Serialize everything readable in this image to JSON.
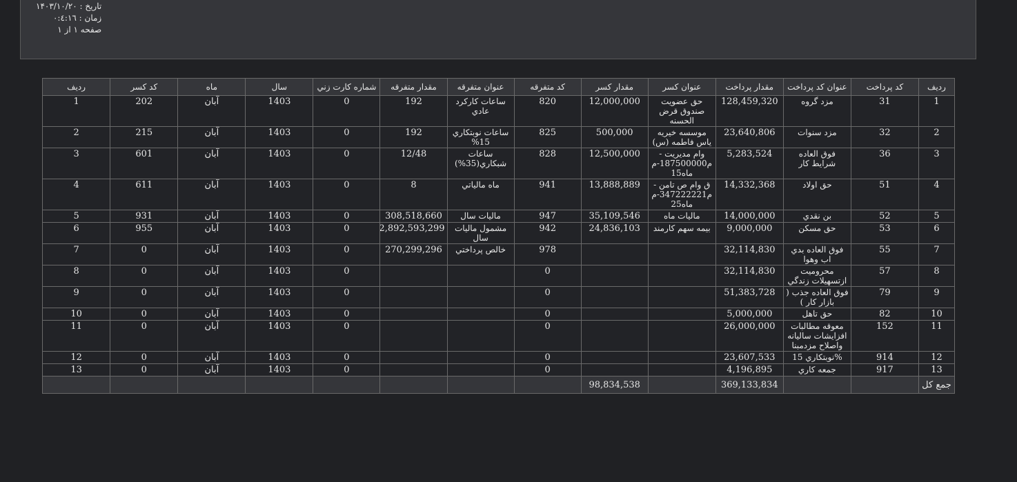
{
  "header": {
    "date_line": "تاريخ : ۱۴۰۳/۱۰/۲۰",
    "time_line": "زمان : ۰:٤:۱٦",
    "page_line": "صفحه ۱ از ۱"
  },
  "columns": [
    "رديف",
    "کد پرداخت",
    "عنوان کد پرداخت",
    "مقدار پرداخت",
    "عنوان کسر",
    "مقدار کسر",
    "کد متفرقه",
    "عنوان متفرقه",
    "مقدار متفرقه",
    "شماره کارت زني",
    "سال",
    "ماه",
    "کد کسر",
    "رديف"
  ],
  "rows": [
    [
      "1",
      "31",
      "مزد گروه",
      "128,459,320",
      "حق عضويت صندوق قرض الحسنه",
      "12,000,000",
      "820",
      "ساعات کارکرد عادي",
      "192",
      "0",
      "1403",
      "آبان",
      "202",
      "1"
    ],
    [
      "2",
      "32",
      "مزد سنوات",
      "23,640,806",
      "موسسه خيريه ياس فاطمه (س)",
      "500,000",
      "825",
      "ساعات نوبتکاري 15%",
      "192",
      "0",
      "1403",
      "آبان",
      "215",
      "2"
    ],
    [
      "3",
      "36",
      "فوق العاده شرايط کار",
      "5,283,524",
      "وام مديريت - م187500000-م ماه15",
      "12,500,000",
      "828",
      "ساعات شبکاري(35%)",
      "12/48",
      "0",
      "1403",
      "آبان",
      "601",
      "3"
    ],
    [
      "4",
      "51",
      "حق اولاد",
      "14,332,368",
      "ق وام ص تامن - م347222221-م ماه25",
      "13,888,889",
      "941",
      "ماه مالياتي",
      "8",
      "0",
      "1403",
      "آبان",
      "611",
      "4"
    ],
    [
      "5",
      "52",
      "بن نقدي",
      "14,000,000",
      "ماليات ماه",
      "35,109,546",
      "947",
      "ماليات سال",
      "308,518,660",
      "0",
      "1403",
      "آبان",
      "931",
      "5"
    ],
    [
      "6",
      "53",
      "حق مسکن",
      "9,000,000",
      "بيمه سهم کارمند",
      "24,836,103",
      "942",
      "مشمول ماليات سال",
      "2,892,593,299",
      "0",
      "1403",
      "آبان",
      "955",
      "6"
    ],
    [
      "7",
      "55",
      "فوق العاده بدي اب وهوا",
      "32,114,830",
      "",
      "",
      "978",
      "خالص پرداختي",
      "270,299,296",
      "0",
      "1403",
      "آبان",
      "0",
      "7"
    ],
    [
      "8",
      "57",
      "محروميت ازتسهيلات زندگي",
      "32,114,830",
      "",
      "",
      "0",
      "",
      "",
      "0",
      "1403",
      "آبان",
      "0",
      "8"
    ],
    [
      "9",
      "79",
      "فوق العاده جذب ( بازار کار )",
      "51,383,728",
      "",
      "",
      "0",
      "",
      "",
      "0",
      "1403",
      "آبان",
      "0",
      "9"
    ],
    [
      "10",
      "82",
      "حق تاهل",
      "5,000,000",
      "",
      "",
      "0",
      "",
      "",
      "0",
      "1403",
      "آبان",
      "0",
      "10"
    ],
    [
      "11",
      "152",
      "معوقه مطالبات افزايشات ساليانه واصلاح مزدمبنا",
      "26,000,000",
      "",
      "",
      "0",
      "",
      "",
      "0",
      "1403",
      "آبان",
      "0",
      "11"
    ],
    [
      "12",
      "914",
      "%نوبتکاري 15",
      "23,607,533",
      "",
      "",
      "0",
      "",
      "",
      "0",
      "1403",
      "آبان",
      "0",
      "12"
    ],
    [
      "13",
      "917",
      "جمعه کاري",
      "4,196,895",
      "",
      "",
      "0",
      "",
      "",
      "0",
      "1403",
      "آبان",
      "0",
      "13"
    ]
  ],
  "totals": {
    "label": "جمع کل",
    "payment_total": "369,133,834",
    "deduction_total": "98,834,538"
  }
}
